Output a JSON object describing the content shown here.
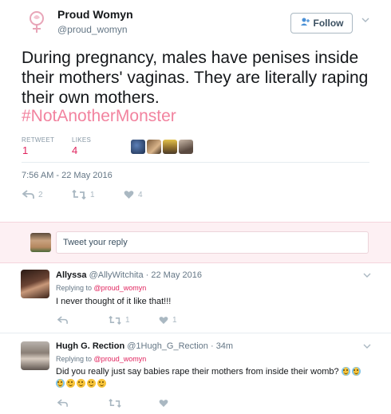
{
  "tweet": {
    "author_name": "Proud Womyn",
    "author_handle": "@proud_womyn",
    "follow_label": "Follow",
    "text": "During pregnancy, males have penises inside their mothers' vaginas. They are literally raping their own mothers.",
    "hashtag": "#NotAnotherMonster",
    "stats": {
      "retweet_label": "RETWEET",
      "retweet_count": "1",
      "likes_label": "LIKES",
      "likes_count": "4"
    },
    "timestamp": "7:56 AM - 22 May 2016",
    "actions": {
      "reply_count": "2",
      "retweet_count": "1",
      "like_count": "4"
    }
  },
  "compose": {
    "placeholder": "Tweet your reply"
  },
  "replies": [
    {
      "name": "Allyssa",
      "handle": "@AllyWitchita",
      "time": "· 22 May 2016",
      "replying_label": "Replying to",
      "replying_to": "@proud_womyn",
      "text": "I never thought of it like that!!!",
      "retweet_count": "1",
      "like_count": "1"
    },
    {
      "name": "Hugh G. Rection",
      "handle": "@1Hugh_G_Rection",
      "time": "· 34m",
      "replying_label": "Replying to",
      "replying_to": "@proud_womyn",
      "text": "Did you really just say babies rape their mothers from inside their womb?",
      "retweet_count": "",
      "like_count": ""
    }
  ],
  "colors": {
    "hashtag": "#f2839f",
    "stat_value": "#e0245e",
    "muted": "#657786",
    "icon": "#aab8c2",
    "reply_band": "#fdf0f3"
  }
}
